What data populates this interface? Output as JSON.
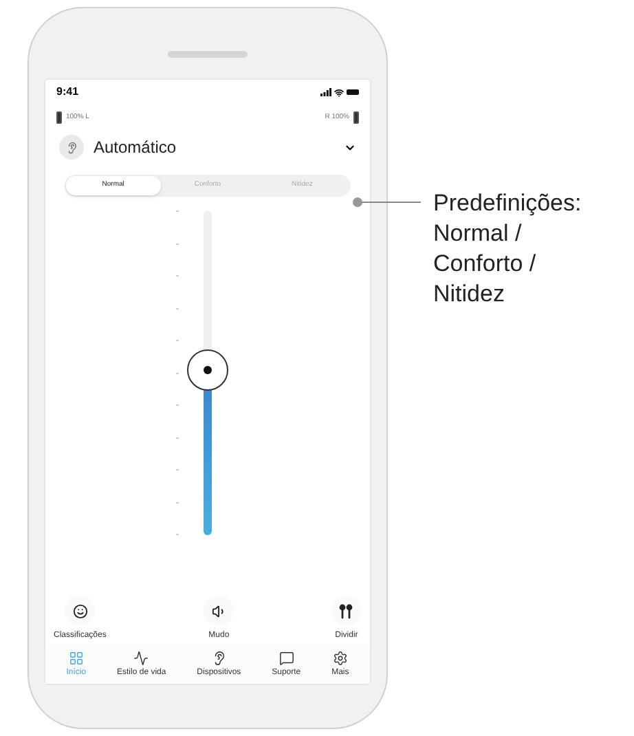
{
  "status_bar": {
    "time": "9:41"
  },
  "batteries": {
    "left": "100% L",
    "right": "R 100%"
  },
  "program": {
    "name": "Automático"
  },
  "presets": [
    {
      "label": "Normal",
      "selected": true
    },
    {
      "label": "Conforto",
      "selected": false
    },
    {
      "label": "Nitidez",
      "selected": false
    }
  ],
  "volume_slider": {
    "level": 0.51
  },
  "actions": [
    {
      "label": "Classificações"
    },
    {
      "label": "Mudo"
    },
    {
      "label": "Dividir"
    }
  ],
  "nav": [
    {
      "label": "Início",
      "selected": true
    },
    {
      "label": "Estilo de vida",
      "selected": false
    },
    {
      "label": "Dispositivos",
      "selected": false
    },
    {
      "label": "Suporte",
      "selected": false
    },
    {
      "label": "Mais",
      "selected": false
    }
  ],
  "callout": {
    "lines": [
      "Predefinições:",
      "Normal /",
      "Conforto /",
      "Nitidez"
    ]
  }
}
